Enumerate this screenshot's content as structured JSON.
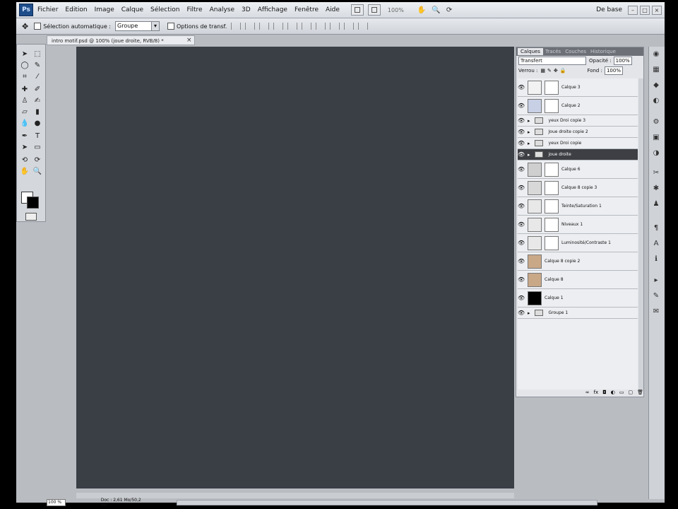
{
  "app": {
    "logo": "Ps",
    "workspace": "De base"
  },
  "menu": [
    "Fichier",
    "Edition",
    "Image",
    "Calque",
    "Sélection",
    "Filtre",
    "Analyse",
    "3D",
    "Affichage",
    "Fenêtre",
    "Aide"
  ],
  "zoom_field": "100%",
  "options": {
    "auto_select_label": "Sélection automatique :",
    "auto_select_value": "Groupe",
    "transform_label": "Options de transf."
  },
  "document": {
    "tab_title": "intro motif.psd @ 100% (joue droite, RVB/8) *"
  },
  "layers_panel": {
    "tabs": [
      "Calques",
      "Tracés",
      "Couches",
      "Historique"
    ],
    "blend_mode": "Transfert",
    "opacity_label": "Opacité :",
    "opacity_value": "100%",
    "lock_label": "Verrou :",
    "fill_label": "Fond :",
    "fill_value": "100%",
    "layers": [
      {
        "name": "Calque 3",
        "kind": "layer",
        "thumb": "#f2f2f2",
        "mask": true
      },
      {
        "name": "Calque 2",
        "kind": "layer",
        "thumb": "#c8d0e6",
        "mask": true
      },
      {
        "name": "yeux Droi copie 3",
        "kind": "group"
      },
      {
        "name": "Joue droite copie 2",
        "kind": "group"
      },
      {
        "name": "yeux Droi copie",
        "kind": "group"
      },
      {
        "name": "joue droite",
        "kind": "group",
        "selected": true
      },
      {
        "name": "Calque 6",
        "kind": "layer",
        "thumb": "#cfcfcf",
        "mask": true
      },
      {
        "name": "Calque 8 copie 3",
        "kind": "layer",
        "thumb": "#d8d8d8",
        "mask": true
      },
      {
        "name": "Teinte/Saturation 1",
        "kind": "adjust",
        "thumb": "#e8e8e8",
        "mask": true
      },
      {
        "name": "Niveaux 1",
        "kind": "adjust",
        "thumb": "#e8e8e8",
        "mask": true
      },
      {
        "name": "Luminosité/Contraste 1",
        "kind": "adjust",
        "thumb": "#e8e8e8",
        "mask": true
      },
      {
        "name": "Calque 8 copie 2",
        "kind": "layer",
        "thumb": "#c9a888",
        "mask": false
      },
      {
        "name": "Calque 8",
        "kind": "layer",
        "thumb": "#c9a888",
        "mask": false
      },
      {
        "name": "Calque 1",
        "kind": "layer",
        "thumb": "#000000",
        "mask": false
      },
      {
        "name": "Groupe 1",
        "kind": "group"
      }
    ]
  },
  "status": {
    "zoom": "100 %",
    "doc": "Doc : 2,61 Mo/50,2 Mo"
  }
}
